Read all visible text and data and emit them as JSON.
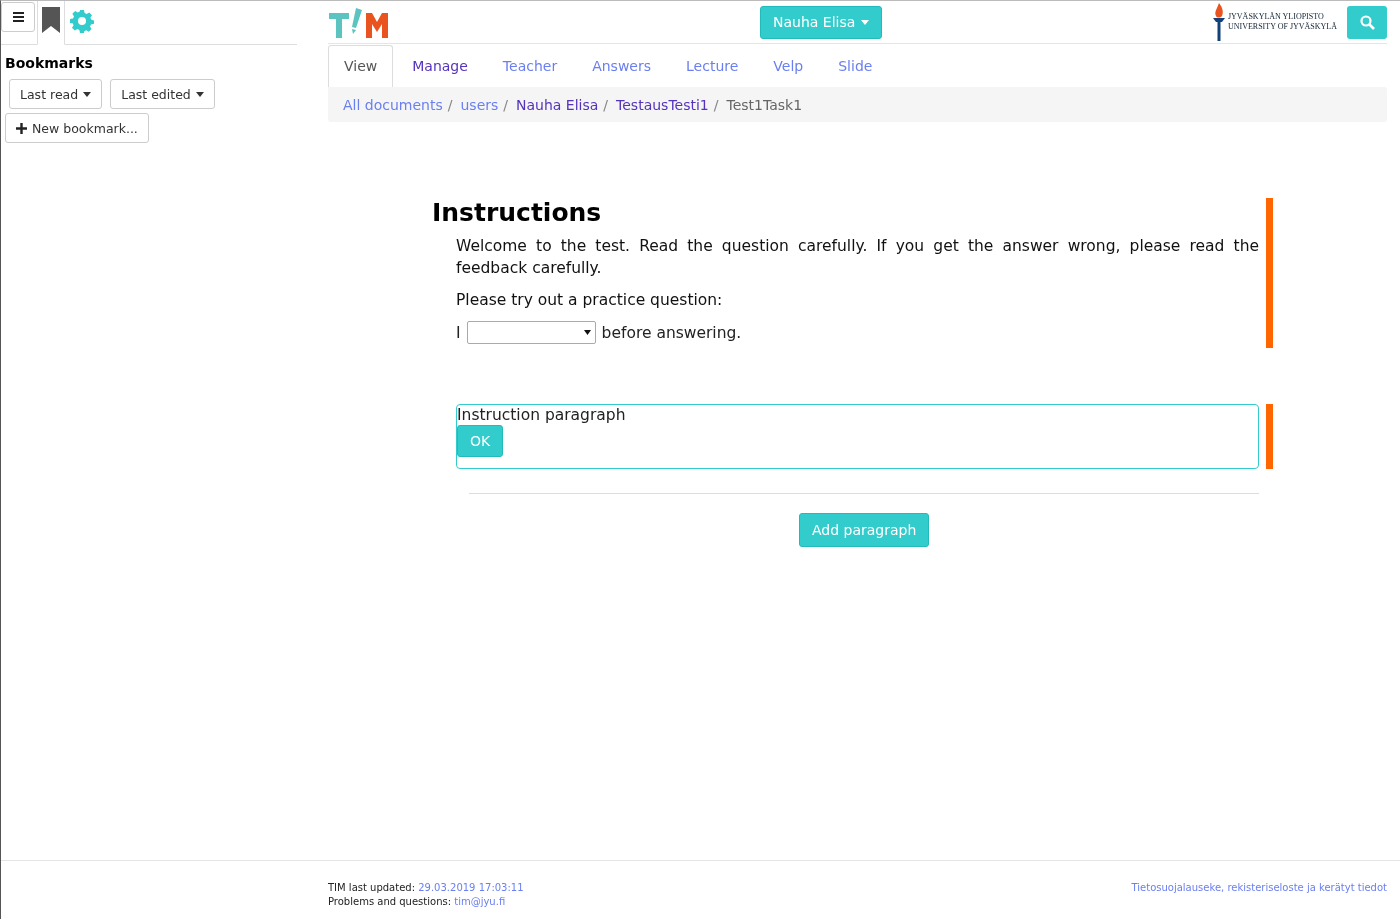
{
  "sidebar": {
    "title": "Bookmarks",
    "dropdowns": [
      "Last read",
      "Last edited"
    ],
    "new_bookmark": "New bookmark..."
  },
  "header": {
    "user_menu": "Nauha Elisa",
    "university_logo": [
      "JYVÄSKYLÄN YLIOPISTO",
      "UNIVERSITY OF JYVÄSKYLÄ"
    ]
  },
  "tabs": [
    {
      "label": "View",
      "selected": true
    },
    {
      "label": "Manage",
      "selected": false,
      "visited": true
    },
    {
      "label": "Teacher",
      "selected": false,
      "visited": false
    },
    {
      "label": "Answers",
      "selected": false,
      "visited": false
    },
    {
      "label": "Lecture",
      "selected": false,
      "visited": false
    },
    {
      "label": "Velp",
      "selected": false,
      "visited": false
    },
    {
      "label": "Slide",
      "selected": false,
      "visited": false
    }
  ],
  "breadcrumb": [
    {
      "label": "All documents",
      "visited": false,
      "separator": "/"
    },
    {
      "label": "users",
      "visited": false,
      "separator": "/"
    },
    {
      "label": "Nauha Elisa",
      "visited": true,
      "separator": "/"
    },
    {
      "label": "TestausTesti1",
      "visited": true,
      "separator": "/"
    }
  ],
  "breadcrumb_current": "Test1Task1",
  "document": {
    "heading": "Instructions",
    "paragraphs": [
      "Welcome to the test. Read the question carefully. If you get the answer wrong, please read the feedback carefully.",
      "Please try out a practice question:"
    ],
    "question": {
      "before": "I",
      "after": "before answering."
    }
  },
  "editor": {
    "text": "Instruction paragraph",
    "button": "OK"
  },
  "add_paragraph": "Add paragraph",
  "footer": {
    "updated_label": "TIM last updated:",
    "updated_value": "29.03.2019 17:03:11",
    "contact_label": "Problems and questions:",
    "contact_value": "tim@jyu.fi",
    "privacy_link": "Tietosuojalauseke, rekisteriseloste ja kerätyt tiedot"
  }
}
